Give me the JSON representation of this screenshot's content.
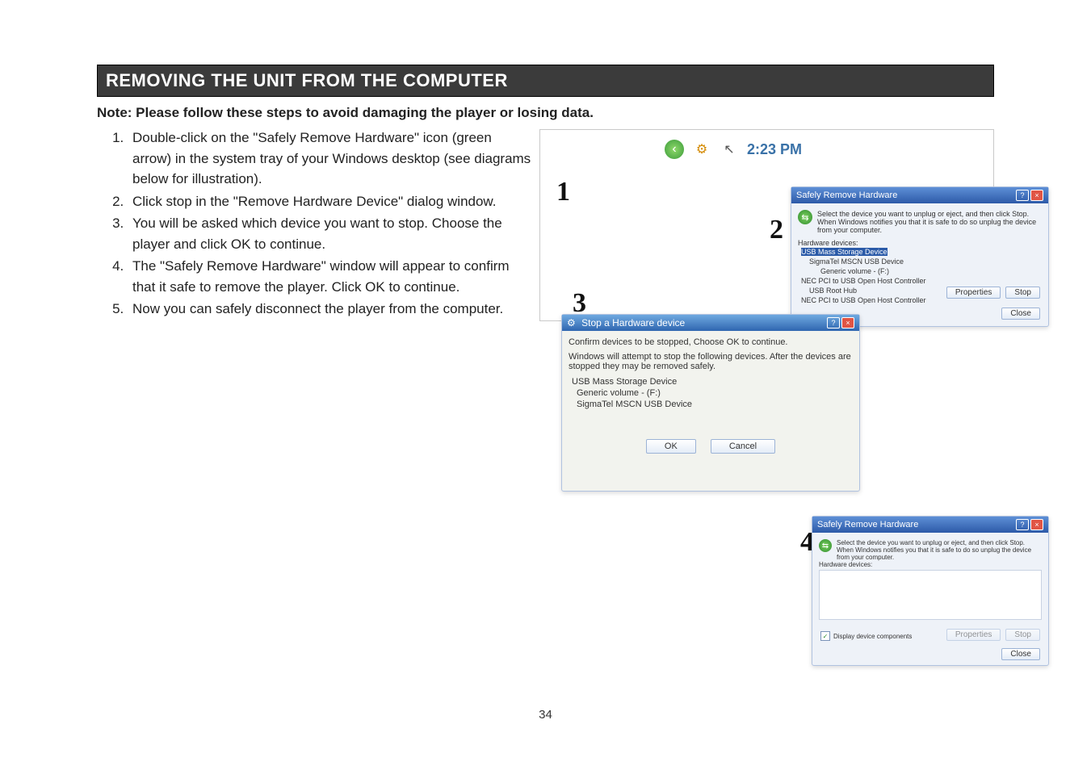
{
  "heading": "REMOVING THE UNIT FROM THE COMPUTER",
  "note": "Note: Please follow these steps to avoid damaging the player or losing data.",
  "steps": [
    "Double-click on the \"Safely Remove Hardware\" icon (green arrow) in the system tray of your Windows desktop (see diagrams below for illustration).",
    "Click stop in the \"Remove Hardware Device\" dialog window.",
    "You will be asked which device you want to stop. Choose the player and click OK to continue.",
    "The \"Safely Remove Hardware\" window will appear to confirm that it safe to remove the player. Click OK to continue.",
    "Now you can safely disconnect the player from the computer."
  ],
  "tray": {
    "clock": "2:23 PM"
  },
  "numbers": {
    "n1": "1",
    "n2": "2",
    "n3": "3",
    "n4": "4"
  },
  "w1": {
    "title": "Safely Remove Hardware",
    "intro": "Select the device you want to unplug or eject, and then click Stop. When Windows notifies you that it is safe to do so unplug the device from your computer.",
    "hw_label": "Hardware devices:",
    "items": [
      "USB Mass Storage Device",
      "SigmaTel MSCN USB Device",
      "Generic volume - (F:)",
      "NEC PCI to USB Open Host Controller",
      "USB Root Hub",
      "NEC PCI to USB Open Host Controller"
    ],
    "properties": "Properties",
    "stop": "Stop",
    "close": "Close"
  },
  "w2": {
    "title": "Stop a Hardware device",
    "line1": "Confirm devices to be stopped, Choose OK to continue.",
    "line2": "Windows will attempt to stop the following devices. After the devices are stopped they may be removed safely.",
    "items": [
      "USB Mass Storage Device",
      "Generic volume - (F:)",
      "SigmaTel MSCN USB Device"
    ],
    "ok": "OK",
    "cancel": "Cancel"
  },
  "w3": {
    "title": "Safely Remove Hardware",
    "intro": "Select the device you want to unplug or eject, and then click Stop. When Windows notifies you that it is safe to do so unplug the device from your computer.",
    "hw_label": "Hardware devices:",
    "checkbox": "Display device components",
    "properties": "Properties",
    "stop": "Stop",
    "close": "Close"
  },
  "page_number": "34"
}
